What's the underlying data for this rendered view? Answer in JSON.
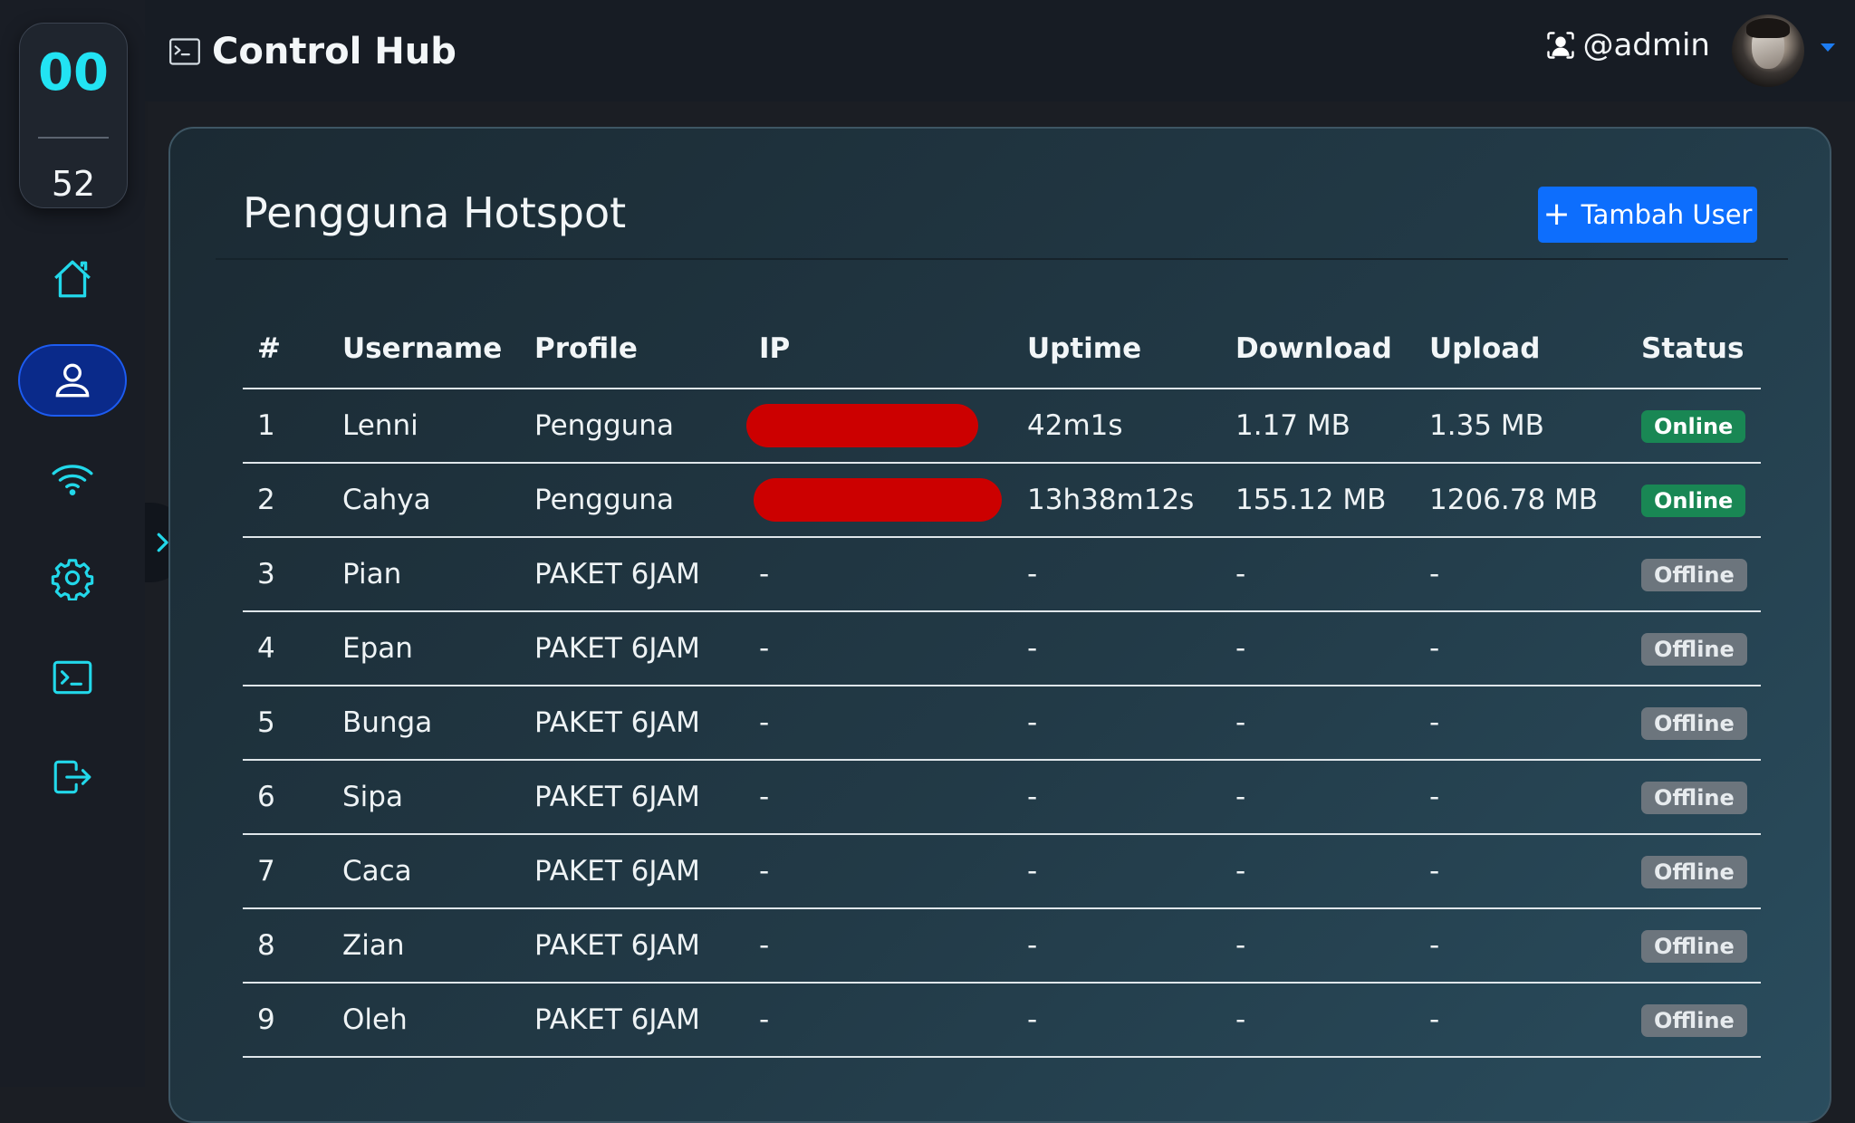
{
  "clock": {
    "hours": "00",
    "minutes": "52"
  },
  "sidebar": {
    "items": [
      {
        "name": "home",
        "icon": "home-icon",
        "active": false
      },
      {
        "name": "users",
        "icon": "user-icon",
        "active": true
      },
      {
        "name": "hotspot",
        "icon": "wifi-icon",
        "active": false
      },
      {
        "name": "settings",
        "icon": "gear-icon",
        "active": false
      },
      {
        "name": "terminal",
        "icon": "terminal-icon",
        "active": false
      },
      {
        "name": "logout",
        "icon": "logout-icon",
        "active": false
      }
    ],
    "collapse_icon": "chevron-right-icon"
  },
  "header": {
    "title": "Control Hub",
    "brand_icon": "terminal-icon",
    "user_icon": "user-badge-icon",
    "username": "@admin"
  },
  "main": {
    "title": "Pengguna Hotspot",
    "add_button": "Tambah User",
    "table": {
      "columns": [
        "#",
        "Username",
        "Profile",
        "IP",
        "Uptime",
        "Download",
        "Upload",
        "Status"
      ],
      "rows": [
        {
          "num": "1",
          "username": "Lenni",
          "profile": "Pengguna",
          "ip": "",
          "ip_redacted": true,
          "uptime": "42m1s",
          "download": "1.17 MB",
          "upload": "1.35 MB",
          "status": "Online"
        },
        {
          "num": "2",
          "username": "Cahya",
          "profile": "Pengguna",
          "ip": "",
          "ip_redacted": true,
          "uptime": "13h38m12s",
          "download": "155.12 MB",
          "upload": "1206.78 MB",
          "status": "Online"
        },
        {
          "num": "3",
          "username": "Pian",
          "profile": "PAKET 6JAM",
          "ip": "-",
          "ip_redacted": false,
          "uptime": "-",
          "download": "-",
          "upload": "-",
          "status": "Offline"
        },
        {
          "num": "4",
          "username": "Epan",
          "profile": "PAKET 6JAM",
          "ip": "-",
          "ip_redacted": false,
          "uptime": "-",
          "download": "-",
          "upload": "-",
          "status": "Offline"
        },
        {
          "num": "5",
          "username": "Bunga",
          "profile": "PAKET 6JAM",
          "ip": "-",
          "ip_redacted": false,
          "uptime": "-",
          "download": "-",
          "upload": "-",
          "status": "Offline"
        },
        {
          "num": "6",
          "username": "Sipa",
          "profile": "PAKET 6JAM",
          "ip": "-",
          "ip_redacted": false,
          "uptime": "-",
          "download": "-",
          "upload": "-",
          "status": "Offline"
        },
        {
          "num": "7",
          "username": "Caca",
          "profile": "PAKET 6JAM",
          "ip": "-",
          "ip_redacted": false,
          "uptime": "-",
          "download": "-",
          "upload": "-",
          "status": "Offline"
        },
        {
          "num": "8",
          "username": "Zian",
          "profile": "PAKET 6JAM",
          "ip": "-",
          "ip_redacted": false,
          "uptime": "-",
          "download": "-",
          "upload": "-",
          "status": "Offline"
        },
        {
          "num": "9",
          "username": "Oleh",
          "profile": "PAKET 6JAM",
          "ip": "-",
          "ip_redacted": false,
          "uptime": "-",
          "download": "-",
          "upload": "-",
          "status": "Offline"
        }
      ]
    }
  },
  "colors": {
    "accent": "#22d8ea",
    "primary_button": "#0d6efd",
    "online": "#198754",
    "offline": "#6c757d",
    "redaction": "#cc0000"
  }
}
